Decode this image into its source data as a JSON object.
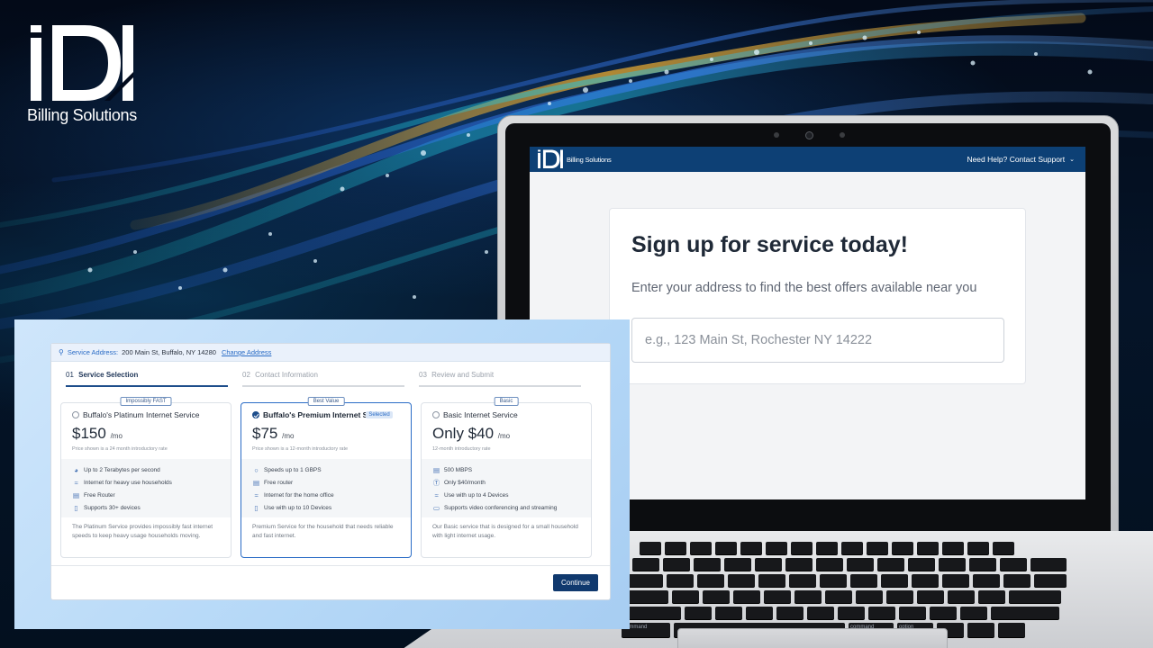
{
  "brand": {
    "logo_text": "Billing Solutions",
    "mini_logo_text": "Billing Solutions"
  },
  "laptop": {
    "help_link": "Need Help? Contact Support",
    "signup": {
      "title": "Sign up for service today!",
      "subtitle": "Enter your address to find the best offers available near you",
      "address_placeholder": "e.g., 123 Main St, Rochester NY 14222"
    }
  },
  "selection": {
    "address_label": "Service Address:",
    "address_value": "200 Main St, Buffalo, NY 14280",
    "change_address": "Change Address",
    "steps": [
      {
        "num": "01",
        "label": "Service Selection"
      },
      {
        "num": "02",
        "label": "Contact Information"
      },
      {
        "num": "03",
        "label": "Review and Submit"
      }
    ],
    "plans": [
      {
        "tag": "Impossibly FAST",
        "name": "Buffalo's Platinum Internet Service",
        "price": "$150",
        "per": "/mo",
        "note": "Price shown is a 24 month introductory rate",
        "features": [
          {
            "icon": "gauge-icon",
            "text": "Up to 2 Terabytes per second"
          },
          {
            "icon": "wifi-icon",
            "text": "Internet for heavy use households"
          },
          {
            "icon": "router-icon",
            "text": "Free Router"
          },
          {
            "icon": "device-icon",
            "text": "Supports 30+ devices"
          }
        ],
        "description": "The Platinum Service provides impossibly fast internet speeds to keep heavy usage households moving."
      },
      {
        "tag": "Best Value",
        "name": "Buffalo's Premium Internet S",
        "selected_badge": "Selected",
        "price": "$75",
        "per": "/mo",
        "note": "Price shown is a 12-month introductory rate",
        "features": [
          {
            "icon": "globe-icon",
            "text": "Speeds up to 1 GBPS"
          },
          {
            "icon": "router-icon",
            "text": "Free router"
          },
          {
            "icon": "wifi-icon",
            "text": "Internet for the home office"
          },
          {
            "icon": "device-icon",
            "text": "Use with up to 10 Devices"
          }
        ],
        "description": "Premium Service for the household that needs reliable and fast internet."
      },
      {
        "tag": "Basic",
        "name": "Basic Internet Service",
        "price": "Only $40",
        "per": "/mo",
        "note": "12-month introductory rate",
        "features": [
          {
            "icon": "router-icon",
            "text": "500 MBPS"
          },
          {
            "icon": "dollar-icon",
            "text": "Only $40/month"
          },
          {
            "icon": "wifi-icon",
            "text": "Use with up to 4 Devices"
          },
          {
            "icon": "cast-icon",
            "text": "Supports video conferencing and streaming"
          }
        ],
        "description": "Our Basic service that is designed for a small household with light internet usage."
      }
    ],
    "continue_label": "Continue"
  },
  "keyboard": {
    "command_label": "command",
    "option_label": "option"
  },
  "colors": {
    "brand_navy": "#0d4075",
    "accent_blue": "#2a6cc6",
    "button_navy": "#10396e"
  }
}
